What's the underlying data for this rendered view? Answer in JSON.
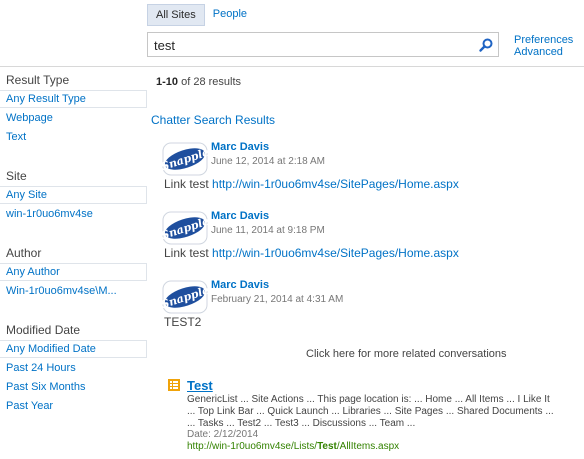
{
  "scope_tabs": [
    {
      "label": "All Sites",
      "active": true
    },
    {
      "label": "People",
      "active": false
    }
  ],
  "search": {
    "value": "test",
    "icon": "search-icon"
  },
  "links": {
    "preferences": "Preferences",
    "advanced": "Advanced"
  },
  "refiners": {
    "result_type": {
      "title": "Result Type",
      "items": [
        "Any Result Type",
        "Webpage",
        "Text"
      ]
    },
    "site": {
      "title": "Site",
      "items": [
        "Any Site",
        "win-1r0uo6mv4se"
      ]
    },
    "author": {
      "title": "Author",
      "items": [
        "Any Author",
        "Win-1r0uo6mv4se\\M..."
      ]
    },
    "modified_date": {
      "title": "Modified Date",
      "items": [
        "Any Modified Date",
        "Past 24 Hours",
        "Past Six Months",
        "Past Year"
      ]
    }
  },
  "results": {
    "count_range": "1-10",
    "count_of": "of 28 results",
    "chatter_title": "Chatter Search Results",
    "posts": [
      {
        "author": "Marc Davis",
        "date": "June 12, 2014 at 2:18 AM",
        "text": "Link test",
        "link": "http://win-1r0uo6mv4se/SitePages/Home.aspx"
      },
      {
        "author": "Marc Davis",
        "date": "June 11, 2014 at 9:18 PM",
        "text": "Link test",
        "link": "http://win-1r0uo6mv4se/SitePages/Home.aspx"
      },
      {
        "author": "Marc Davis",
        "date": "February 21, 2014 at 4:31 AM",
        "text": "TEST2",
        "link": ""
      }
    ],
    "avatar_text": "Snapple",
    "more_conversations": "Click here for more related conversations",
    "doc": {
      "title": "Test",
      "summary_line1": "GenericList ... Site Actions ... This page location is: ... Home ... All Items ... I Like It",
      "summary_line2": "... Top Link Bar ... Quick Launch ... Libraries ... Site Pages ... Shared Documents ...",
      "summary_line3": "... Tasks ... Test2 ... Test3 ... Discussions ... Team ...",
      "date": "Date: 2/12/2014",
      "url_prefix": "http://win-1r0uo6mv4se/Lists/",
      "url_bold": "Test",
      "url_suffix": "/AllItems.aspx"
    }
  },
  "colors": {
    "link": "#0072c6",
    "url": "#338200",
    "tab_active_bg": "#e1e8f2",
    "avatar_blue": "#1f4f9e",
    "doc_icon": "#f0a30a"
  }
}
